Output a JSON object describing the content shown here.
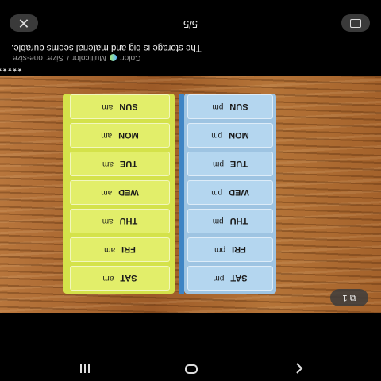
{
  "navbar": {
    "back_icon": "back-icon",
    "home_icon": "home-icon",
    "recents_icon": "recents-icon"
  },
  "review": {
    "stars_icon": "star-rating-icon",
    "color_label": "Color:",
    "color_value": "Multicolor",
    "separator": "/",
    "size_label": "Size:",
    "size_value": "one-size",
    "text": "The storage is big and material seems durable."
  },
  "photo": {
    "more_button_label": "⧉ 1",
    "days": [
      "SAT",
      "FRI",
      "THU",
      "WED",
      "TUE",
      "MON",
      "SUN"
    ],
    "pm_label": "pm",
    "am_label": "am"
  },
  "bottom_bar": {
    "counter": "5/5",
    "close_icon": "close-icon",
    "close_glyph": "✕"
  },
  "colors": {
    "wood": "#a4622b",
    "blue_compartment": "#b4d6ef",
    "yellow_compartment": "#e2ee6a",
    "divider": "#3e84c4"
  }
}
